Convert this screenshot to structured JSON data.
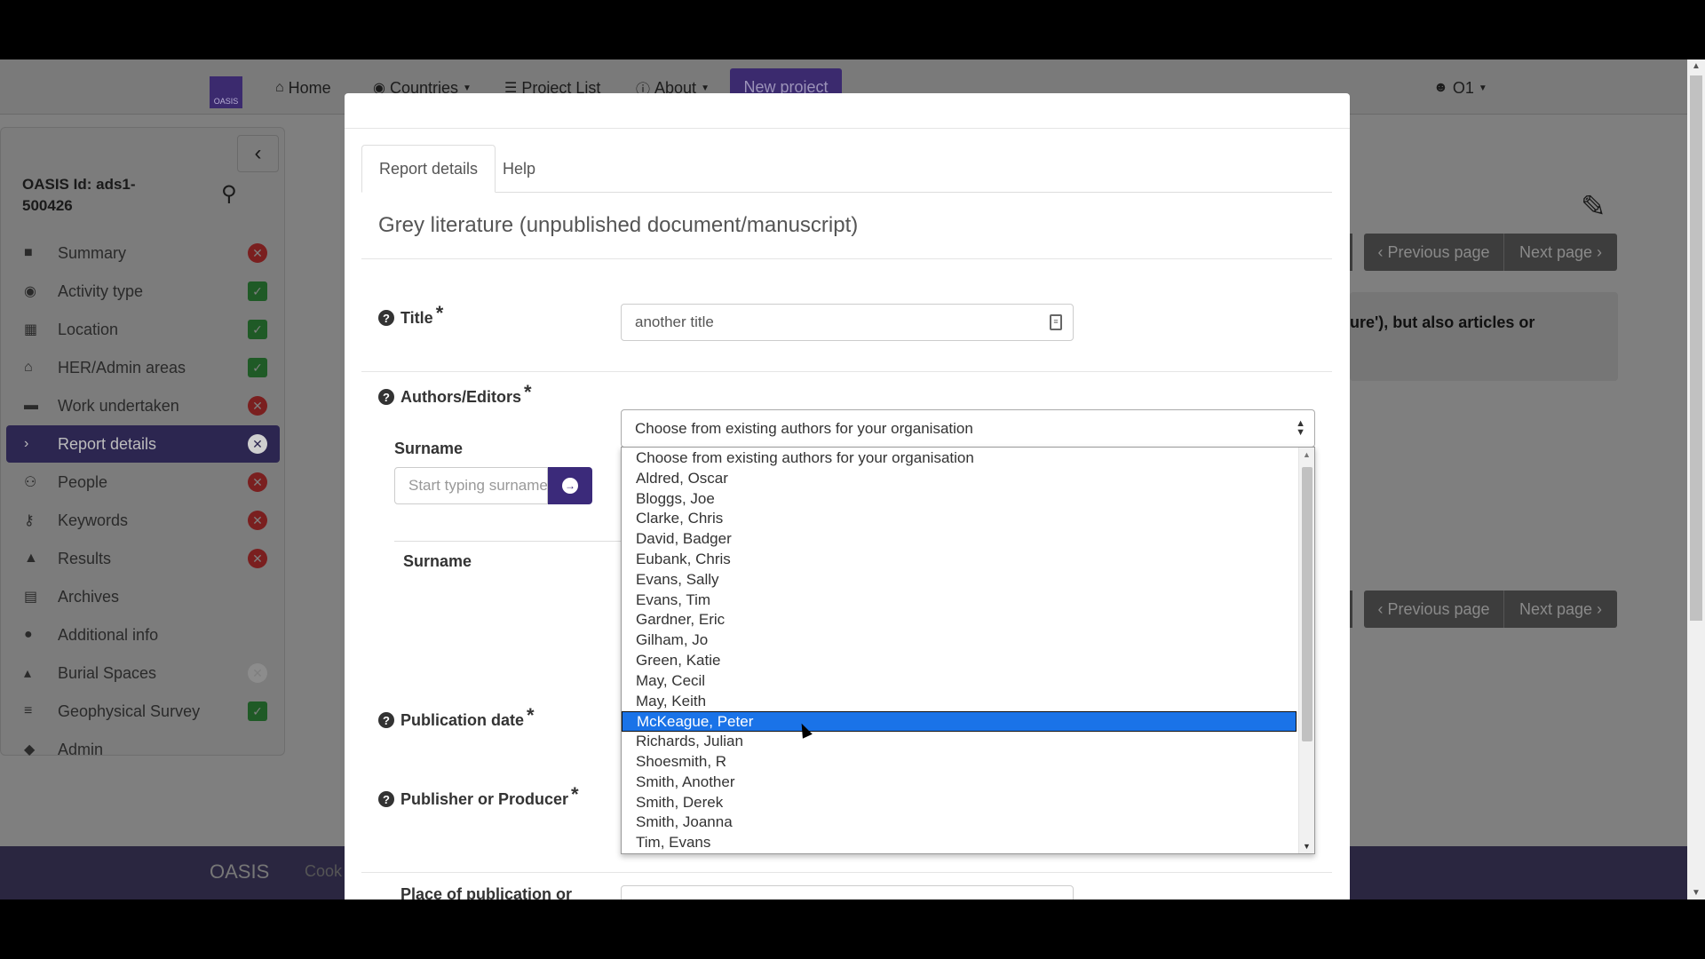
{
  "navbar": {
    "logo_text": "OASIS",
    "home": "Home",
    "countries": "Countries",
    "project_list": "Project List",
    "about": "About",
    "new_project": "New project",
    "user": "O1"
  },
  "sidebar": {
    "oasis_id": "OASIS Id: ads1-500426",
    "items": [
      {
        "label": "Summary",
        "icon": "file-icon",
        "status": "incomplete"
      },
      {
        "label": "Activity type",
        "icon": "globe-icon",
        "status": "complete"
      },
      {
        "label": "Location",
        "icon": "map-icon",
        "status": "complete"
      },
      {
        "label": "HER/Admin areas",
        "icon": "institution-icon",
        "status": "complete"
      },
      {
        "label": "Work undertaken",
        "icon": "briefcase-icon",
        "status": "incomplete"
      },
      {
        "label": "Report details",
        "icon": "chevron-right-icon",
        "status": "incomplete",
        "active": true
      },
      {
        "label": "People",
        "icon": "users-icon",
        "status": "incomplete"
      },
      {
        "label": "Keywords",
        "icon": "key-icon",
        "status": "incomplete"
      },
      {
        "label": "Results",
        "icon": "graduation-cap-icon",
        "status": "incomplete"
      },
      {
        "label": "Archives",
        "icon": "archive-icon",
        "status": "none"
      },
      {
        "label": "Additional info",
        "icon": "info-icon",
        "status": "none"
      },
      {
        "label": "Burial Spaces",
        "icon": "bell-icon",
        "status": "disabled"
      },
      {
        "label": "Geophysical Survey",
        "icon": "layers-icon",
        "status": "complete"
      },
      {
        "label": "Admin",
        "icon": "tags-icon",
        "status": "none"
      }
    ]
  },
  "background": {
    "previous_page": "Previous page",
    "next_page": "Next page",
    "info_text": "ure'), but also articles or"
  },
  "footer": {
    "brand": "OASIS",
    "link": "Cook"
  },
  "modal": {
    "tabs": [
      "Report details",
      "Help"
    ],
    "section_title": "Grey literature (unpublished document/manuscript)",
    "title_label": "Title",
    "title_value": "another title",
    "authors_label": "Authors/Editors",
    "authors_select_value": "Choose from existing authors for your organisation",
    "surname_label": "Surname",
    "surname_placeholder": "Start typing surname",
    "table_header_surname": "Surname",
    "publication_date_label": "Publication date",
    "publisher_label": "Publisher or Producer",
    "place_label": "Place of publication or production",
    "required_mark": "*",
    "author_options": [
      "Choose from existing authors for your organisation",
      "Aldred, Oscar",
      "Bloggs, Joe",
      "Clarke, Chris",
      "David, Badger",
      "Eubank, Chris",
      "Evans, Sally",
      "Evans, Tim",
      "Gardner, Eric",
      "Gilham, Jo",
      "Green, Katie",
      "May, Cecil",
      "May, Keith",
      "McKeague, Peter",
      "Richards, Julian",
      "Shoesmith, R",
      "Smith, Another",
      "Smith, Derek",
      "Smith, Joanna",
      "Tim, Evans"
    ],
    "selected_option": "McKeague, Peter"
  },
  "colors": {
    "brand_purple": "#3b2a6e",
    "selected_blue": "#1a73e8",
    "incomplete_red": "#7a1f1f",
    "complete_green": "#1f5a26"
  }
}
